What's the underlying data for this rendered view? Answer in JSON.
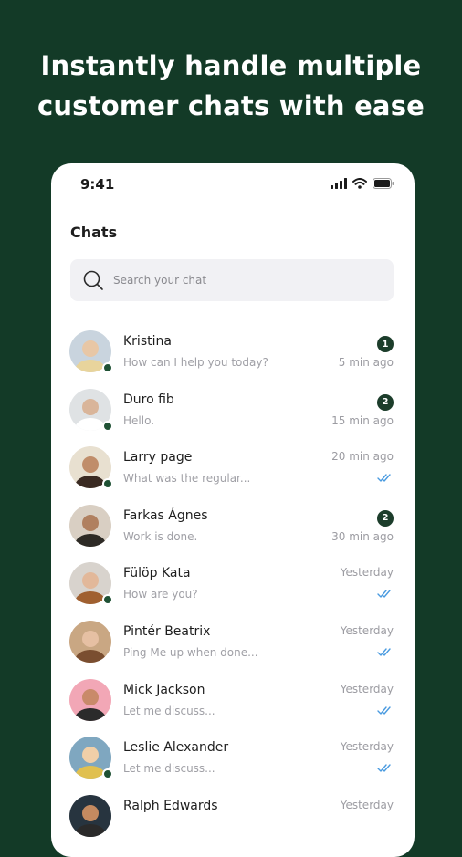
{
  "headline": [
    "Instantly handle multiple",
    "customer chats with ease"
  ],
  "status_bar": {
    "time": "9:41"
  },
  "page_title": "Chats",
  "search": {
    "placeholder": "Search your chat"
  },
  "colors": {
    "background": "#133a27",
    "badge": "#1c3d2b",
    "read_ticks": "#4a9be0"
  },
  "chats": [
    {
      "name": "Kristina",
      "preview": "How can I help you today?",
      "time": "5 min ago",
      "unread": "1",
      "online": true,
      "read": false
    },
    {
      "name": "Duro fib",
      "preview": "Hello.",
      "time": "15 min ago",
      "unread": "2",
      "online": true,
      "read": false
    },
    {
      "name": "Larry page",
      "preview": "What was the regular...",
      "time": "20 min ago",
      "unread": "",
      "online": true,
      "read": true
    },
    {
      "name": "Farkas Ágnes",
      "preview": "Work is done.",
      "time": "30 min ago",
      "unread": "2",
      "online": false,
      "read": false
    },
    {
      "name": "Fülöp Kata",
      "preview": "How are you?",
      "time": "Yesterday",
      "unread": "",
      "online": true,
      "read": true
    },
    {
      "name": "Pintér Beatrix",
      "preview": "Ping Me up when done...",
      "time": "Yesterday",
      "unread": "",
      "online": false,
      "read": true
    },
    {
      "name": "Mick Jackson",
      "preview": "Let me discuss...",
      "time": "Yesterday",
      "unread": "",
      "online": false,
      "read": true
    },
    {
      "name": "Leslie Alexander",
      "preview": "Let me discuss...",
      "time": "Yesterday",
      "unread": "",
      "online": true,
      "read": true
    },
    {
      "name": "Ralph Edwards",
      "preview": "",
      "time": "Yesterday",
      "unread": "",
      "online": false,
      "read": false
    }
  ]
}
